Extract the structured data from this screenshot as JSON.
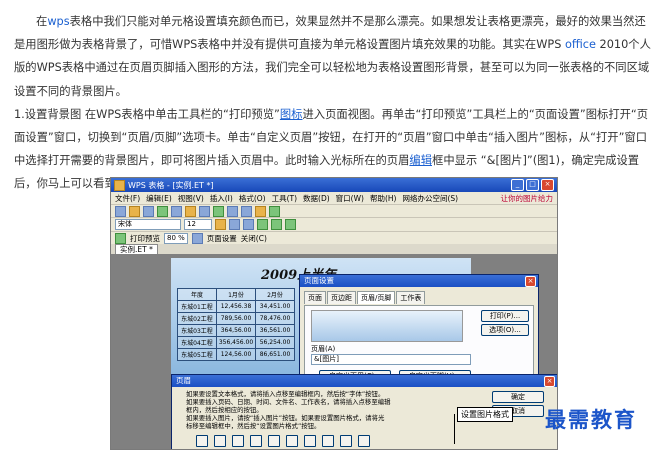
{
  "article": {
    "p1": {
      "before_link": "在",
      "link_wps": "wps",
      "mid1": "表格中我们只能对单元格设置填充颜色而已，效果显然并不是那么漂亮。如果想发让表格更漂亮，最好的效果当然还是用图形做为表格背景了，可惜WPS表格中并没有提供可直接为单元格设置图片填充效果的功能。其实在WPS ",
      "link_office": "office",
      "after_office": " 2010个人版的WPS表格中通过在页眉页脚插入图形的方法，我们完全可以轻松地为表格设置图形背景，甚至可以为同一张表格的不同区域设置不同的背景图片。"
    },
    "p2": {
      "lead": "1.设置背景图     在WPS表格中单击工具栏的“打印预览”",
      "link_icon": "图标",
      "mid1": "进入页面视图。再单击“打印预览”工具栏上的“页面设置”图标打开“页面设置”窗口，切换到“页眉/页脚”选项卡。单击“自定义页眉”按钮，在打开的“页眉”窗口中单击“插入图片”图标，从“打开”窗口中选择打开需要的背景图片，即可将图片插入页眉中。此时输入光标所在的页眉",
      "link_edit": "编辑",
      "after": "框中显示 “&[图片]”(图1)，确定完成设置后，你马上可以看到表格的图片背景效果。"
    }
  },
  "screenshot": {
    "window_title": "WPS 表格 - [实例.ET *]",
    "menu": [
      "文件(F)",
      "编辑(E)",
      "视图(V)",
      "插入(I)",
      "格式(O)",
      "工具(T)",
      "数据(D)",
      "窗口(W)",
      "帮助(H)",
      "网络办公空间(S)"
    ],
    "menu_right": "让你的图片给力",
    "font_name": "宋体",
    "font_size": "12",
    "preview_bar": {
      "print": "打印预览",
      "zoom": "80 %",
      "pages": "页面设置",
      "close": "关闭(C)"
    },
    "doc_tab": "实例.ET *",
    "sheet_title": "2009上半年",
    "table_header": [
      "年度",
      "1月份",
      "2月份"
    ],
    "table_rows": [
      [
        "东城01工程",
        "12,456.38",
        "34,451.00"
      ],
      [
        "东城02工程",
        "789,56.00",
        "78,476.00"
      ],
      [
        "东城03工程",
        "364,56.00",
        "36,561.00"
      ],
      [
        "东城04工程",
        "356,456.00",
        "56,254.00"
      ],
      [
        "东城05工程",
        "124,56.00",
        "86,651.00"
      ]
    ],
    "page_setup": {
      "title": "页面设置",
      "tabs": [
        "页面",
        "页边距",
        "页眉/页脚",
        "工作表"
      ],
      "print_btn": "打印(P)...",
      "options_btn": "选项(O)...",
      "header_label": "页眉(A)",
      "header_value": "&[图片]",
      "custom_header_btn": "自定义页眉(C)...",
      "custom_footer_btn": "自定义页脚(U)..."
    },
    "header_dialog": {
      "title": "页眉",
      "lines": [
        "如果要设置文本格式，请将插入点移至编辑框内，然后按“字体”按钮。",
        "如果要插入页码、日期、时间、文件名、工作表名，请将插入点移至编辑",
        "框内，然后按相应的按钮。",
        "如果要插入图片，请按“插入图片”按钮。如果要设置图片格式，请将光",
        "标移至编辑框中，然后按“设置图片格式”按钮。"
      ],
      "ok": "确定",
      "cancel": "取消"
    },
    "callout": "设置图片格式"
  },
  "watermark": "最需教育"
}
